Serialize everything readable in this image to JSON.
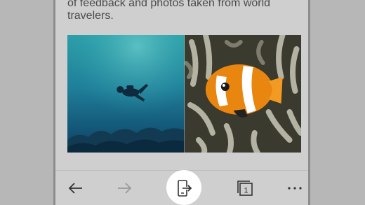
{
  "article": {
    "line1": "of feedback and photos taken from world",
    "line2": "travelers."
  },
  "photos": [
    {
      "icon": "scuba-diver-photo"
    },
    {
      "icon": "clownfish-photo"
    }
  ],
  "toolbar": {
    "tabs_count": "1",
    "back_icon": "arrow-left-icon",
    "forward_icon": "arrow-right-icon",
    "continue_on_pc_icon": "phone-send-icon",
    "tabs_icon": "tabs-icon",
    "more_icon": "more-icon"
  },
  "colors": {
    "overlay": "#b7b7b7",
    "page": "#cfcfcf",
    "highlight": "#ffffff",
    "icon": "#333333",
    "icon_disabled": "#9a9a9a"
  }
}
